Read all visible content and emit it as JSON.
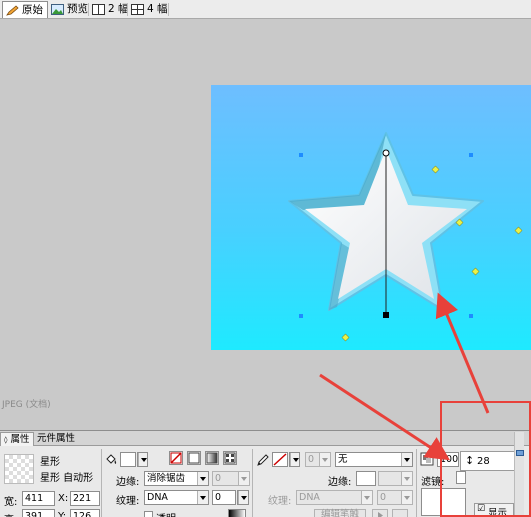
{
  "tabs": [
    {
      "label": "原始",
      "icon": "pencil-icon"
    },
    {
      "label": "预览",
      "icon": "image-preview-icon"
    },
    {
      "label": "2 幅",
      "icon": "two-up-icon"
    },
    {
      "label": "4 幅",
      "icon": "four-up-icon"
    }
  ],
  "canvas": {
    "doc_label": "JPEG (文档)",
    "background_color": "#c9c9c9",
    "image_gradient": [
      "#6ebeff",
      "#1eeaff"
    ]
  },
  "panel": {
    "tabs": [
      "属性",
      "元件属性"
    ],
    "object_name": "星形",
    "object_type": "星形  自动形",
    "width_label": "宽:",
    "width_value": "411",
    "height_label": "高:",
    "height_value": "391",
    "x_label": "X:",
    "x_value": "221",
    "y_label": "Y:",
    "y_value": "126",
    "fill": {
      "edge_label": "边缘:",
      "edge_value": "消除锯齿",
      "edge_amount": "0",
      "texture_label": "纹理:",
      "texture_value": "DNA",
      "texture_amount": "0",
      "transparent_label": "透明"
    },
    "stroke": {
      "amount": "0",
      "style": "无",
      "edge_label": "边缘:",
      "texture_label": "纹理:",
      "texture_value": "DNA",
      "texture_amount": "0",
      "edit_label": "编辑笔触"
    },
    "opacity_value": "100",
    "filter_label": "滤镜:",
    "roundness_value": "28",
    "show_label": "显示"
  },
  "colors": {
    "highlight": "#e8413a",
    "star_outer": "#7fd6f4",
    "star_inner": "#f4f6f8"
  }
}
